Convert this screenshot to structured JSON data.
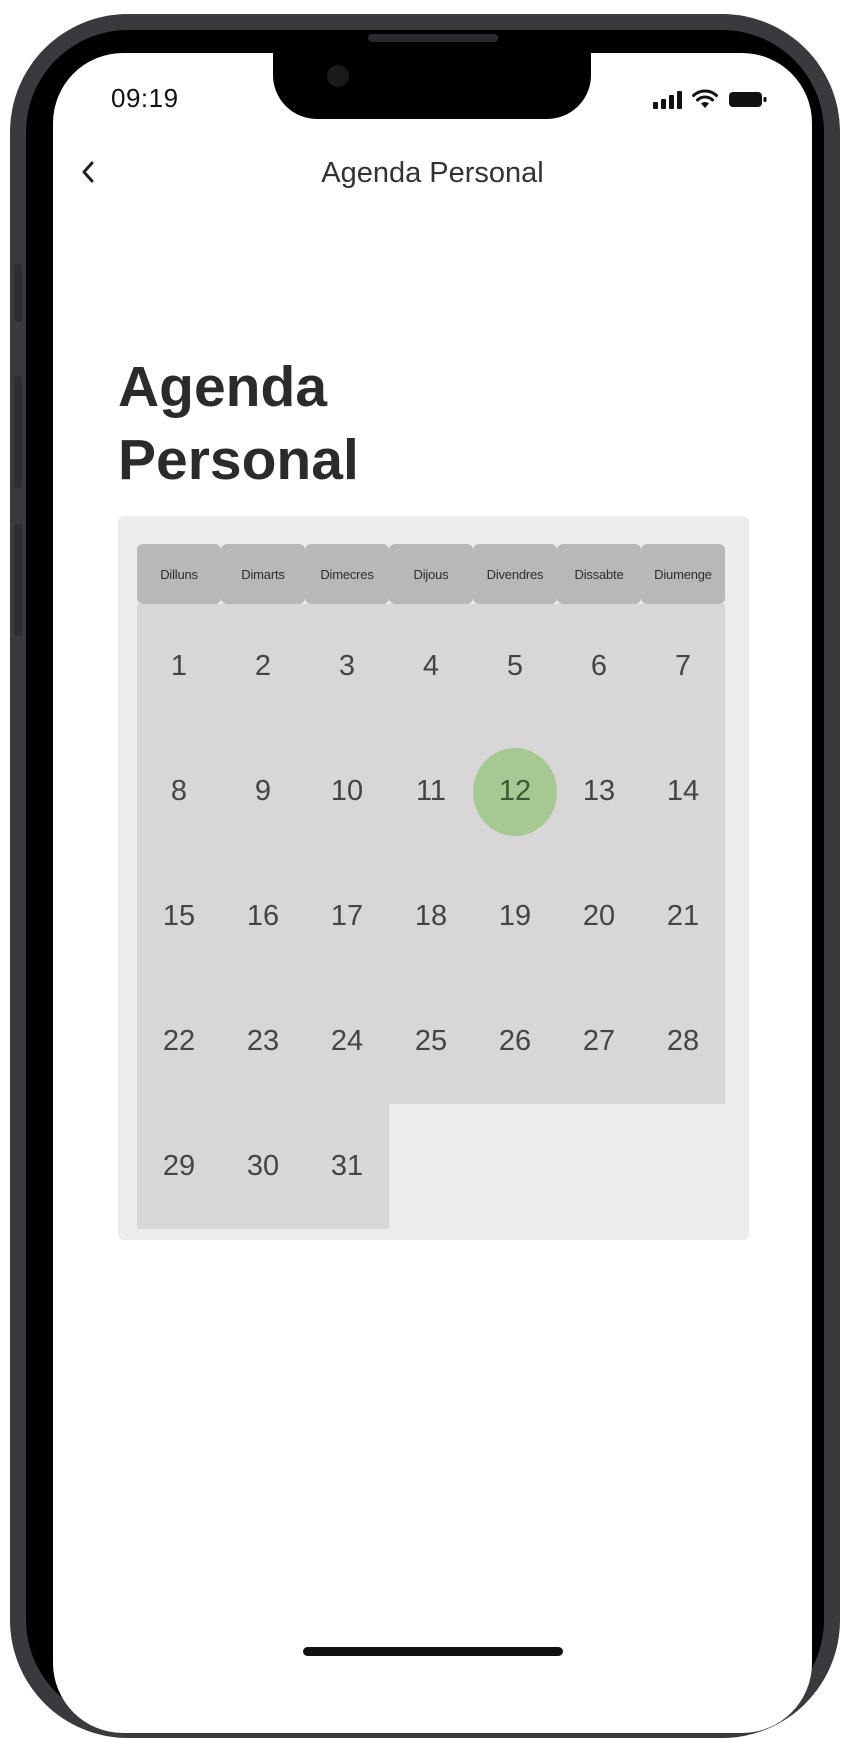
{
  "status_bar": {
    "time": "09:19"
  },
  "nav": {
    "back_icon": "chevron-left-icon",
    "title": "Agenda Personal"
  },
  "page": {
    "heading_line1": "Agenda",
    "heading_line2": "Personal"
  },
  "calendar": {
    "weekdays": [
      "Dilluns",
      "Dimarts",
      "Dimecres",
      "Dijous",
      "Divendres",
      "Dissabte",
      "Diumenge"
    ],
    "days": [
      "1",
      "2",
      "3",
      "4",
      "5",
      "6",
      "7",
      "8",
      "9",
      "10",
      "11",
      "12",
      "13",
      "14",
      "15",
      "16",
      "17",
      "18",
      "19",
      "20",
      "21",
      "22",
      "23",
      "24",
      "25",
      "26",
      "27",
      "28",
      "29",
      "30",
      "31"
    ],
    "selected_day": "12",
    "colors": {
      "panel": "#ececec",
      "header_cell": "#b9b7b8",
      "day_cell": "#d8d6d7",
      "selected": "#a6c892"
    }
  }
}
